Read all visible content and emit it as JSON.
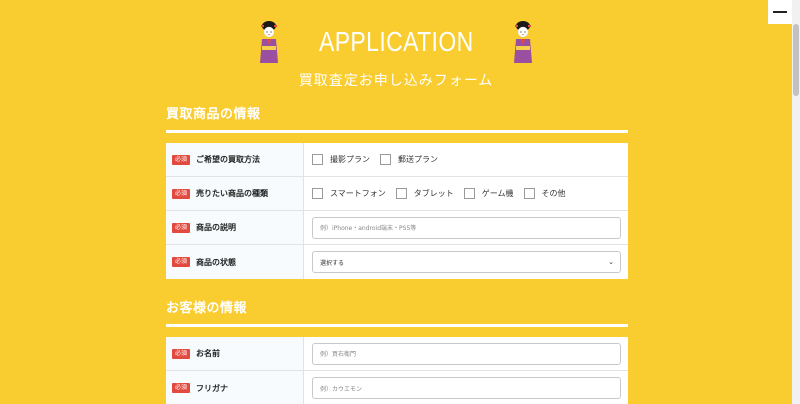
{
  "header": {
    "title": "APPLICATION",
    "subtitle": "買取査定お申し込みフォーム"
  },
  "section1": {
    "heading": "買取商品の情報",
    "rows": [
      {
        "badge": "必須",
        "label": "ご希望の買取方法",
        "type": "checkbox",
        "options": [
          "撮影プラン",
          "郵送プラン"
        ]
      },
      {
        "badge": "必須",
        "label": "売りたい商品の種類",
        "type": "checkbox",
        "options": [
          "スマートフォン",
          "タブレット",
          "ゲーム機",
          "その他"
        ]
      },
      {
        "badge": "必須",
        "label": "商品の説明",
        "type": "input",
        "placeholder": "例）iPhone・android端末・PS5等"
      },
      {
        "badge": "必須",
        "label": "商品の状態",
        "type": "select",
        "value": "選択する"
      }
    ]
  },
  "section2": {
    "heading": "お客様の情報",
    "rows": [
      {
        "badge": "必須",
        "label": "お名前",
        "type": "input",
        "placeholder": "例）買右衛門"
      },
      {
        "badge": "必須",
        "label": "フリガナ",
        "type": "input",
        "placeholder": "例）カウエモン"
      }
    ]
  },
  "colors": {
    "background": "#f9cc2f",
    "badge": "#e24a3f",
    "header_cell": "#f7fbfd"
  },
  "icons": {
    "menu": "hamburger-icon",
    "mascot": "maiko-icon",
    "select": "chevron-down-icon"
  }
}
